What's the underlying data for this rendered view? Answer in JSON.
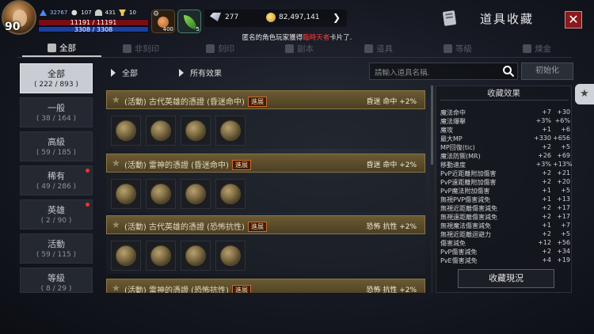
{
  "hud": {
    "level": "90",
    "combat_power": "32767",
    "stat_a": "107",
    "stat_b": "431",
    "stat_c": "10",
    "hp": "11191 / 11191",
    "mp": "3308 / 3308",
    "potion_count": "400",
    "herb_count": "5",
    "diamonds": "277",
    "gold": "82,497,141"
  },
  "notice": {
    "prefix": "匿名的角色玩家獲得",
    "highlight": "臨時天者",
    "suffix": "卡片了."
  },
  "header": {
    "title": "道具收藏",
    "close": "✕"
  },
  "tabs": [
    {
      "label": "全部",
      "active": true
    },
    {
      "label": "非刻印",
      "active": false
    },
    {
      "label": "刻印",
      "active": false
    },
    {
      "label": "副本",
      "active": false
    },
    {
      "label": "道具",
      "active": false
    },
    {
      "label": "等級",
      "active": false
    },
    {
      "label": "煉金",
      "active": false
    }
  ],
  "categories": [
    {
      "name": "全部",
      "count": "( 222 / 893 )",
      "active": true,
      "dot": false
    },
    {
      "name": "一般",
      "count": "( 38 / 164 )",
      "active": false,
      "dot": false
    },
    {
      "name": "高級",
      "count": "( 59 / 185 )",
      "active": false,
      "dot": false
    },
    {
      "name": "稀有",
      "count": "( 49 / 286 )",
      "active": false,
      "dot": true
    },
    {
      "name": "英雄",
      "count": "( 2 / 90 )",
      "active": false,
      "dot": true
    },
    {
      "name": "活動",
      "count": "( 59 / 115 )",
      "active": false,
      "dot": false
    },
    {
      "name": "等級",
      "count": "( 8 / 29 )",
      "active": false,
      "dot": false
    }
  ],
  "filters": {
    "left": "全部",
    "right": "所有效果"
  },
  "search": {
    "placeholder": "請輸入道具名稱.",
    "reset": "初始化"
  },
  "collections": [
    {
      "name": "(活動) 古代英雄的憑證 (昏迷命中)",
      "badge": "進展",
      "effect": "昏迷 命中 +2%"
    },
    {
      "name": "(活動) 雷神的憑證 (昏迷命中)",
      "badge": "進展",
      "effect": "昏迷 命中 +2%"
    },
    {
      "name": "(活動) 古代英雄的憑證 (恐怖抗性)",
      "badge": "進展",
      "effect": "恐怖 抗性 +2%"
    },
    {
      "name": "(活動) 雷神的憑證 (恐怖抗性)",
      "badge": "進展",
      "effect": "恐怖 抗性 +2%"
    }
  ],
  "effects": {
    "title": "收藏效果",
    "rows": [
      {
        "k": "魔法命中",
        "a": "+7",
        "b": "+30"
      },
      {
        "k": "魔法爆擊",
        "a": "+3%",
        "b": "+6%"
      },
      {
        "k": "魔攻",
        "a": "+1",
        "b": "+6"
      },
      {
        "k": "最大MP",
        "a": "+330",
        "b": "+656"
      },
      {
        "k": "MP回復(tic)",
        "a": "+2",
        "b": "+5"
      },
      {
        "k": "魔法防禦(MR)",
        "a": "+26",
        "b": "+69"
      },
      {
        "k": "移動速度",
        "a": "+3%",
        "b": "+13%"
      },
      {
        "k": "PvP近距離附加傷害",
        "a": "+2",
        "b": "+21"
      },
      {
        "k": "PvP遠距離附加傷害",
        "a": "+2",
        "b": "+20"
      },
      {
        "k": "PvP魔法附加傷害",
        "a": "+1",
        "b": "+5"
      },
      {
        "k": "無視PVP傷害減免",
        "a": "+1",
        "b": "+13"
      },
      {
        "k": "無視近距離傷害減免",
        "a": "+2",
        "b": "+17"
      },
      {
        "k": "無視遠距離傷害減免",
        "a": "+2",
        "b": "+17"
      },
      {
        "k": "無視魔法傷害減免",
        "a": "+1",
        "b": "+7"
      },
      {
        "k": "無視近距離迴避力",
        "a": "+2",
        "b": "+5"
      },
      {
        "k": "傷害減免",
        "a": "+12",
        "b": "+56"
      },
      {
        "k": "PvP傷害減免",
        "a": "+2",
        "b": "+34"
      },
      {
        "k": "PvE傷害減免",
        "a": "+4",
        "b": "+19"
      }
    ],
    "button": "收藏現況"
  }
}
